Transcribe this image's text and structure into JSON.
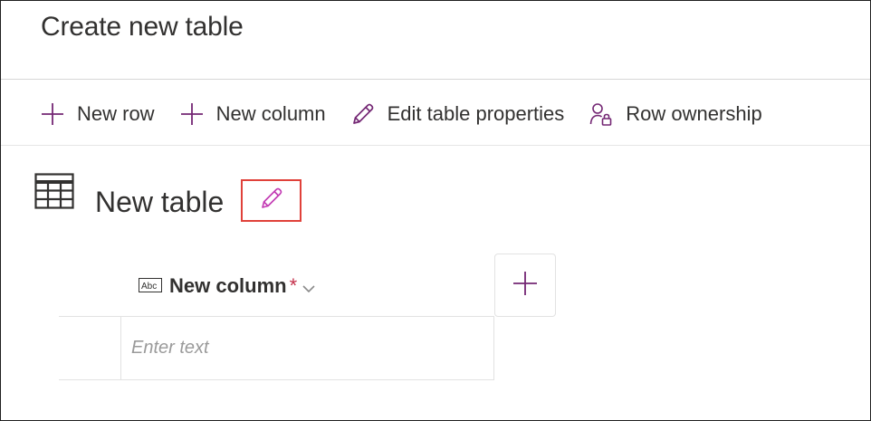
{
  "page": {
    "title": "Create new table"
  },
  "toolbar": {
    "new_row": {
      "label": "New row",
      "icon": "plus-icon"
    },
    "new_column": {
      "label": "New column",
      "icon": "plus-icon"
    },
    "edit_properties": {
      "label": "Edit table properties",
      "icon": "pencil-icon"
    },
    "row_ownership": {
      "label": "Row ownership",
      "icon": "person-lock-icon"
    }
  },
  "table": {
    "name": "New table",
    "icon": "table-grid-icon",
    "edit_icon": "pencil-icon"
  },
  "grid": {
    "column": {
      "name": "New column",
      "required_marker": "*",
      "type_icon_text": "Abc",
      "menu_icon": "chevron-down-icon"
    },
    "add_column_icon": "plus-icon",
    "cell": {
      "placeholder": "Enter text",
      "value": ""
    }
  },
  "colors": {
    "accent": "#742774",
    "accent_light": "#c239b3",
    "highlight_border": "#e0413a",
    "required": "#c4314b",
    "text": "#323130"
  }
}
